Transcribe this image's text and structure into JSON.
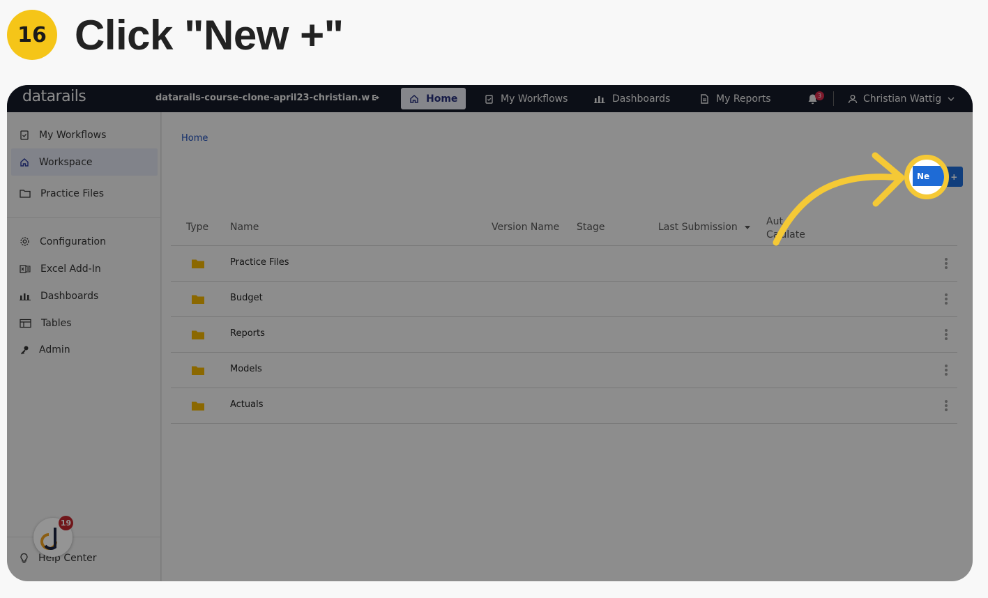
{
  "step": {
    "number": "16",
    "title": "Click \"New +\""
  },
  "topbar": {
    "logo": "datarails",
    "environment": "datarails-course-clone-april23-christian.w",
    "tabs": [
      {
        "label": "Home",
        "icon": "home-icon",
        "active": true
      },
      {
        "label": "My Workflows",
        "icon": "clipboard-icon"
      },
      {
        "label": "Dashboards",
        "icon": "bar-chart-icon"
      },
      {
        "label": "My Reports",
        "icon": "document-icon"
      }
    ],
    "notifications_count": "3",
    "user_name": "Christian Wattig"
  },
  "sidebar": {
    "items": [
      {
        "label": "My Workflows",
        "icon": "clipboard-icon"
      },
      {
        "label": "Workspace",
        "icon": "home-icon",
        "active": true
      },
      {
        "label": "Practice Files",
        "icon": "folder-icon"
      },
      {
        "label": "Configuration",
        "icon": "gear-icon"
      },
      {
        "label": "Excel Add-In",
        "icon": "excel-icon"
      },
      {
        "label": "Dashboards",
        "icon": "bar-chart-icon"
      },
      {
        "label": "Tables",
        "icon": "table-icon"
      },
      {
        "label": "Admin",
        "icon": "key-icon"
      }
    ],
    "help_label": "Help Center",
    "widget_badge": "19"
  },
  "main": {
    "breadcrumb": "Home",
    "new_button_label": "New +",
    "new_button_visible_text": "Ne",
    "columns": [
      "Type",
      "Name",
      "Version Name",
      "Stage",
      "Last Submission",
      "Auto Calculate"
    ],
    "auto_calc_line1": "Aut",
    "auto_calc_line2": "Ca",
    "auto_calc_line2b": "ulate",
    "rows": [
      {
        "name": "Practice Files"
      },
      {
        "name": "Budget"
      },
      {
        "name": "Reports"
      },
      {
        "name": "Models"
      },
      {
        "name": "Actuals"
      }
    ]
  },
  "colors": {
    "accent": "#1e6bd6",
    "highlight": "#f5c936",
    "topbar": "#161a28",
    "folder": "#f0b400"
  }
}
